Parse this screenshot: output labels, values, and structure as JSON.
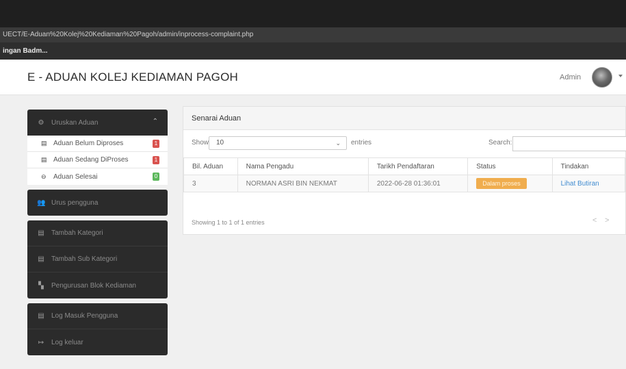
{
  "browser": {
    "url": "UECT/E-Aduan%20Kolej%20Kediaman%20Pagoh/admin/inprocess-complaint.php",
    "bookmark": "ingan Badm..."
  },
  "header": {
    "brand": "E - ADUAN KOLEJ KEDIAMAN PAGOH",
    "user": "Admin"
  },
  "sidebar": {
    "group": {
      "label": "Uruskan Aduan",
      "items": [
        {
          "label": "Aduan Belum Diproses",
          "badge": "1",
          "badge_color": "#d9534f",
          "icon": "table-icon"
        },
        {
          "label": "Aduan Sedang DiProses",
          "badge": "1",
          "badge_color": "#d9534f",
          "icon": "table-icon"
        },
        {
          "label": "Aduan Selesai",
          "badge": "0",
          "badge_color": "#5cb85c",
          "icon": "lock-icon"
        }
      ]
    },
    "users": "Urus pengguna",
    "category": "Tambah Kategori",
    "subcategory": "Tambah Sub Kategori",
    "blocks": "Pengurusan Blok Kediaman",
    "log": "Log Masuk Pengguna",
    "logout": "Log keluar"
  },
  "panel": {
    "title": "Senarai Aduan",
    "show_label": "Show",
    "show_value": "10",
    "entries_label": "entries",
    "search_label": "Search:",
    "columns": [
      "Bil. Aduan",
      "Nama Pengadu",
      "Tarikh Pendaftaran",
      "Status",
      "Tindakan"
    ],
    "rows": [
      {
        "id": "3",
        "name": "NORMAN ASRI BIN NEKMAT",
        "date": "2022-06-28 01:36:01",
        "status": "Dalam proses",
        "action": "Lihat Butiran"
      }
    ],
    "info": "Showing 1 to 1 of 1 entries",
    "prev": "<",
    "next": ">"
  },
  "colors": {
    "sidebar_bg": "#2b2b2b",
    "status_badge": "#f0ad4e",
    "link": "#3f8bd0"
  }
}
